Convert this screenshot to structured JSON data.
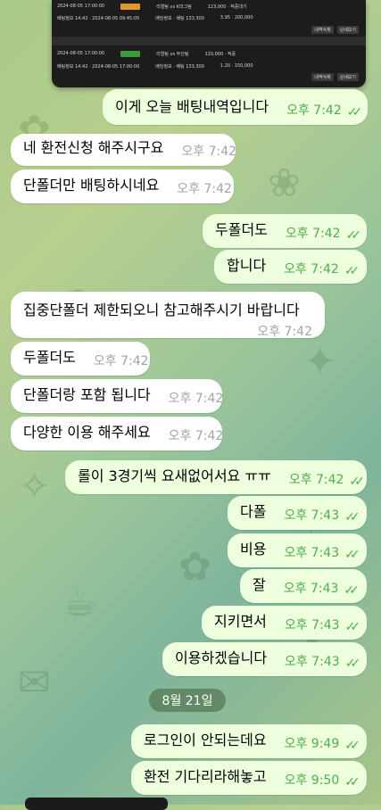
{
  "screenshot": {
    "rows": [
      {
        "left": "2024-08-05 17:00:00",
        "teams": "리얼팀  vs  K리그팀",
        "result": "123,000 · 적중대기"
      },
      {
        "left": "베팅정보 14:42 · 2024-08-05 09:45:05",
        "teams": "배당정보 · 배팅 133,300",
        "result": "3.95 · 200,000"
      },
      {
        "left": "2024-08-05 17:00:00",
        "teams": "리얼팀  vs  부산팀",
        "result": "120,000 · 적중"
      },
      {
        "left": "베팅정보 14:42 · 2024-08-05 17:00:00",
        "teams": "배당정보 · 배팅 133,300",
        "result": "1.20 · 150,000"
      }
    ],
    "buttons": [
      "내역삭제",
      "상세보기"
    ]
  },
  "date_divider": "8월 21일",
  "messages": [
    {
      "dir": "out",
      "text": "이게 오늘 배팅내역입니다",
      "time": "오후 7:42"
    },
    {
      "dir": "in",
      "text": "네 환전신청 해주시구요",
      "time": "오후 7:42"
    },
    {
      "dir": "in",
      "text": "단폴더만 배팅하시네요",
      "time": "오후 7:42"
    },
    {
      "dir": "out",
      "text": "두폴더도",
      "time": "오후 7:42"
    },
    {
      "dir": "out",
      "text": "합니다",
      "time": "오후 7:42"
    },
    {
      "dir": "in",
      "text": "집중단폴더 제한되오니 참고해주시기 바랍니다",
      "time": "오후 7:42"
    },
    {
      "dir": "in",
      "text": "두폴더도",
      "time": "오후 7:42"
    },
    {
      "dir": "in",
      "text": "단폴더랑 포함 됩니다",
      "time": "오후 7:42"
    },
    {
      "dir": "in",
      "text": "다양한 이용 해주세요",
      "time": "오후 7:42"
    },
    {
      "dir": "out",
      "text": "롤이 3경기씩 요새없어서요 ㅠㅠ",
      "time": "오후 7:42"
    },
    {
      "dir": "out",
      "text": "다폴",
      "time": "오후 7:43"
    },
    {
      "dir": "out",
      "text": "비용",
      "time": "오후 7:43"
    },
    {
      "dir": "out",
      "text": "잘",
      "time": "오후 7:43"
    },
    {
      "dir": "out",
      "text": "지키면서",
      "time": "오후 7:43"
    },
    {
      "dir": "out",
      "text": "이용하겠습니다",
      "time": "오후 7:43"
    },
    {
      "dir": "out",
      "text": "로그인이 안되는데요",
      "time": "오후 9:49"
    },
    {
      "dir": "out",
      "text": "환전 기다리라해놓고",
      "time": "오후 9:50"
    }
  ],
  "colors": {
    "outgoing_bubble": "#eeffde",
    "incoming_bubble": "#ffffff",
    "check": "#4fae4e"
  },
  "icons": {
    "read_receipt": "double-check-icon"
  }
}
